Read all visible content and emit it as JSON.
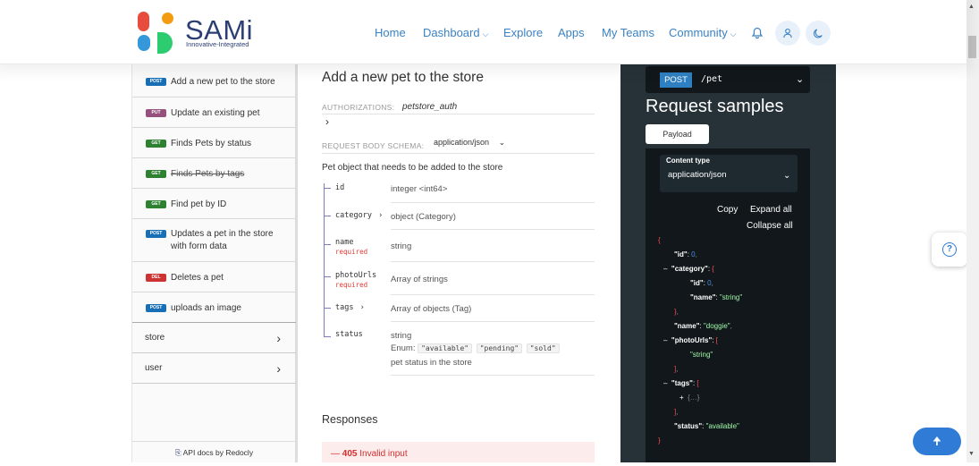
{
  "brand": {
    "name": "SAMi",
    "tagline": "Innovative-Integrated",
    "dot_colors": [
      "#e74c3c",
      "#f39c12",
      "#3498db",
      "#2ecc71"
    ]
  },
  "nav": {
    "links": [
      "Home",
      "Dashboard",
      "Explore",
      "Apps",
      "My Teams",
      "Community"
    ],
    "accent": "#3b82c4"
  },
  "sidebar": {
    "items": [
      {
        "method": "POST",
        "label": "Add a new pet to the store",
        "color": "#186fb5"
      },
      {
        "method": "PUT",
        "label": "Update an existing pet",
        "color": "#95507c"
      },
      {
        "method": "GET",
        "label": "Finds Pets by status",
        "color": "#2f8132"
      },
      {
        "method": "GET",
        "label": "Finds Pets by tags",
        "color": "#2f8132",
        "deprecated": true
      },
      {
        "method": "GET",
        "label": "Find pet by ID",
        "color": "#2f8132"
      },
      {
        "method": "POST",
        "label": "Updates a pet in the store with form data",
        "color": "#186fb5"
      },
      {
        "method": "DEL",
        "label": "Deletes a pet",
        "color": "#cc3333"
      },
      {
        "method": "POST",
        "label": "uploads an image",
        "color": "#186fb5"
      }
    ],
    "groups": [
      "store",
      "user"
    ],
    "footer": "API docs by Redocly"
  },
  "operation": {
    "title": "Add a new pet to the store",
    "auth_label": "AUTHORIZATIONS:",
    "auth_value": "petstore_auth",
    "schema_label": "REQUEST BODY SCHEMA:",
    "schema_value": "application/json",
    "description": "Pet object that needs to be added to the store",
    "fields": [
      {
        "name": "id",
        "type": "integer <int64>"
      },
      {
        "name": "category",
        "type": "object (Category)"
      },
      {
        "name": "name",
        "required": "required",
        "type": "string"
      },
      {
        "name": "photoUrls",
        "required": "required",
        "type": "Array of strings"
      },
      {
        "name": "tags",
        "type": "Array of objects (Tag)"
      },
      {
        "name": "status",
        "type": "string",
        "enum_label": "Enum:",
        "enum": [
          "\"available\"",
          "\"pending\"",
          "\"sold\""
        ],
        "note": "pet status in the store"
      }
    ],
    "responses_title": "Responses",
    "response_405": {
      "code": "405",
      "text": "Invalid input"
    }
  },
  "samples": {
    "method": "POST",
    "path": "/pet",
    "title": "Request samples",
    "tab": "Payload",
    "content_type_label": "Content type",
    "content_type_value": "application/json",
    "actions": [
      "Copy",
      "Expand all",
      "Collapse all"
    ],
    "code": {
      "open_brace": "{",
      "close_brace": "}",
      "id_key": "\"id\"",
      "id_val": "0",
      "category_key": "\"category\"",
      "cat_id_key": "\"id\"",
      "cat_id_val": "0",
      "cat_name_key": "\"name\"",
      "cat_name_val": "\"string\"",
      "name_key": "\"name\"",
      "name_val": "\"doggie\"",
      "photo_key": "\"photoUrls\"",
      "photo_val": "\"string\"",
      "tags_key": "\"tags\"",
      "tags_collapsed": "…",
      "status_key": "\"status\"",
      "status_val": "\"available\"",
      "open_bracket": "[",
      "close_bracket": "]",
      "close_obj": "}"
    }
  }
}
